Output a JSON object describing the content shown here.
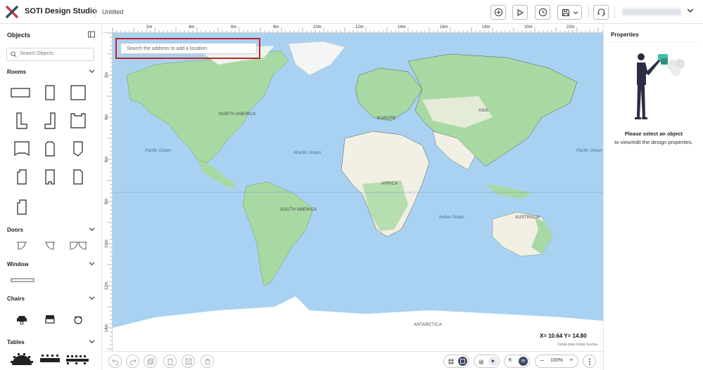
{
  "app": {
    "name": "SOTI Design Studio",
    "document_title": "Untitled"
  },
  "toolbar": {
    "buttons": [
      {
        "name": "add-circle-icon"
      },
      {
        "name": "play-icon"
      },
      {
        "name": "history-icon"
      },
      {
        "name": "save-icon"
      },
      {
        "name": "support-headset-icon"
      }
    ]
  },
  "sidebar": {
    "title": "Objects",
    "search_placeholder": "Search Objects",
    "sections": [
      {
        "title": "Rooms"
      },
      {
        "title": "Doors"
      },
      {
        "title": "Window"
      },
      {
        "title": "Chairs"
      },
      {
        "title": "Tables"
      }
    ]
  },
  "canvas": {
    "address_placeholder": "Search the address to add a location",
    "ruler_x": [
      "2m",
      "4m",
      "6m",
      "8m",
      "10m",
      "12m",
      "14m",
      "16m",
      "18m",
      "20m",
      "22m"
    ],
    "ruler_y": [
      "2m",
      "4m",
      "6m",
      "8m",
      "10m",
      "12m",
      "14m"
    ],
    "continents": [
      "NORTH AMERICA",
      "EUROPE",
      "ASIA",
      "AFRICA",
      "SOUTH AMERICA",
      "AUSTRALIA",
      "ANTARCTICA"
    ],
    "oceans": [
      "Pacific Ocean",
      "Atlantic Ocean",
      "Indian Ocean",
      "Pacific Ocean"
    ],
    "coords": "X= 10.64   Y= 14.80",
    "attribution": "©2025 OSM ©2025 TomTom"
  },
  "bottom_bar": {
    "unit_ft": "ft",
    "unit_m": "m",
    "zoom": "100%"
  },
  "properties": {
    "title": "Properties",
    "empty_title": "Please select an object",
    "empty_body": "to view/edit the design properties."
  },
  "colors": {
    "accent": "#3b6fd8",
    "water": "#a9d2f2",
    "land_green": "#a8d9a3",
    "land_sand": "#f2efe4",
    "highlight": "#c0232c"
  }
}
